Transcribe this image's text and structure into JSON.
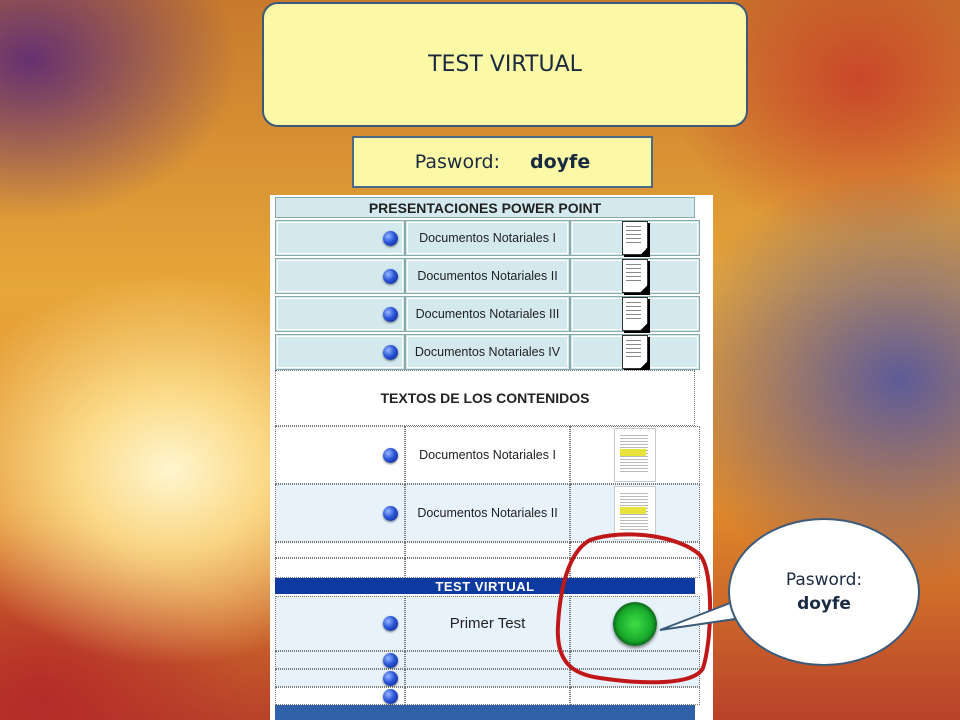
{
  "slide": {
    "title": "TEST VIRTUAL",
    "password_label": "Pasword:",
    "password_value": "doyfe"
  },
  "page": {
    "powerpoint_header": "PRESENTACIONES POWER POINT",
    "powerpoint_items": [
      {
        "label": "Documentos Notariales I",
        "icon": "document-icon"
      },
      {
        "label": "Documentos Notariales II",
        "icon": "document-icon"
      },
      {
        "label": "Documentos Notariales III",
        "icon": "document-icon"
      },
      {
        "label": "Documentos Notariales IV",
        "icon": "document-icon"
      }
    ],
    "textos_header": "TEXTOS DE LOS CONTENIDOS",
    "textos_items": [
      {
        "label": "Documentos Notariales I",
        "icon": "text-document-icon"
      },
      {
        "label": "Documentos Notariales II",
        "icon": "text-document-icon"
      }
    ],
    "test_header": "TEST VIRTUAL",
    "test_items": [
      {
        "label": "Primer Test",
        "icon": "green-button-icon"
      }
    ]
  },
  "callout": {
    "label": "Pasword:",
    "value": "doyfe"
  },
  "colors": {
    "title_fill": "#fbf8a6",
    "border": "#3b5a7a",
    "powerpoint_row": "#d3e9ee",
    "test_header_bar": "#0d3aa0",
    "highlight_circle": "#c01818"
  }
}
